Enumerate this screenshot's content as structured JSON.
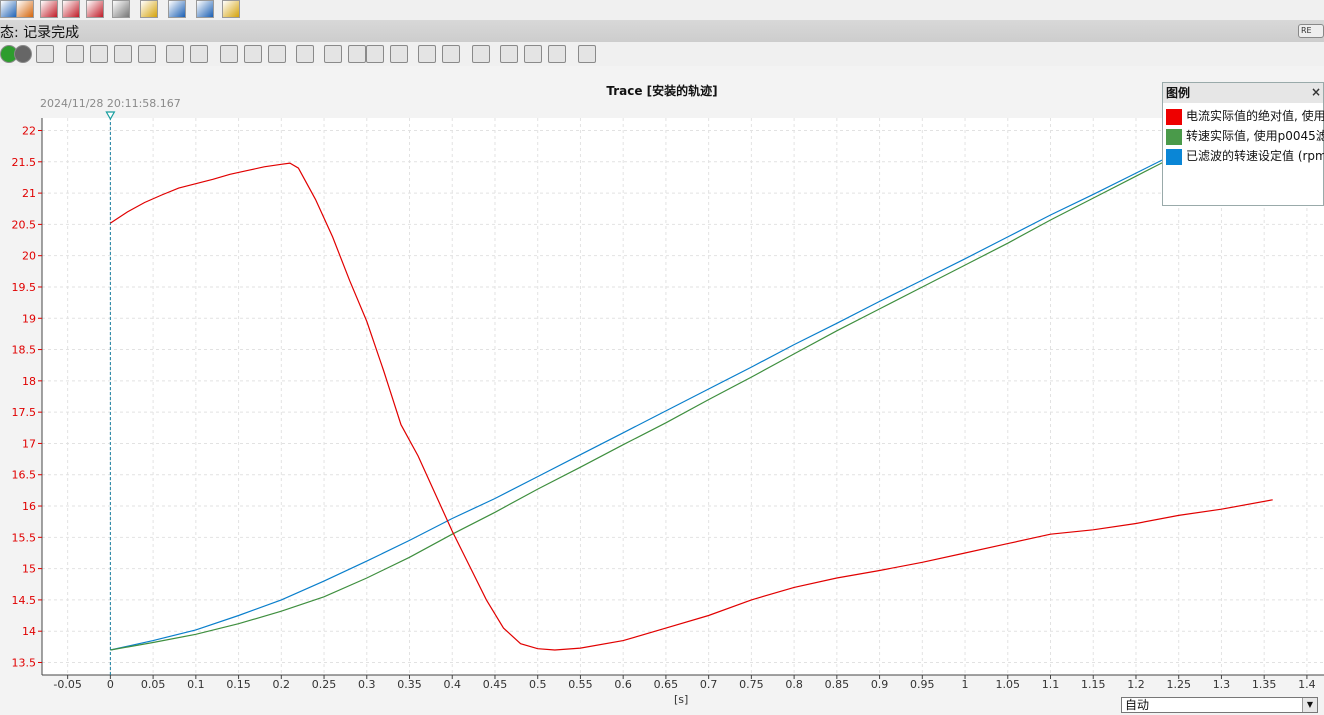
{
  "window": {
    "status_label": "态: 记录完成",
    "rec_badge": "RE"
  },
  "toolbar_icons": [
    "arrow-down-icon",
    "arrow-up-icon",
    "record-icon",
    "record-red-icon",
    "delete-icon",
    "stop-icon",
    "folder-icon",
    "export-icon",
    "import-icon",
    "filter-icon"
  ],
  "toolbar2_icons": [
    "play-green-icon",
    "forward-icon",
    "map-icon",
    "hand-icon",
    "zoom-box-icon",
    "zoom-x-icon",
    "zoom-y-icon",
    "zoom-in-icon",
    "zoom-out-icon",
    "zoom-100-icon",
    "y-100-icon",
    "x-100-icon",
    "chart-icon",
    "time-axis-icon",
    "cursor-icon",
    "line-icon",
    "diagonal-icon",
    "vertical-lines-icon",
    "horizontal-lines-icon",
    "measure-icon",
    "legend-icon",
    "align-left-icon",
    "align-right-icon",
    "download-icon"
  ],
  "chart": {
    "title": "Trace [安装的轨迹]",
    "timestamp": "2024/11/28 20:11:58.167",
    "x_unit": "[s]"
  },
  "legend": {
    "title": "图例",
    "close": "×",
    "items": [
      {
        "label": "电流实际值的绝对值, 使用",
        "color": "#ee0000"
      },
      {
        "label": "转速实际值, 使用p0045滤",
        "color": "#4a9a4a"
      },
      {
        "label": "已滤波的转速设定值 (rpm",
        "color": "#0a86d6"
      }
    ]
  },
  "dropdown": {
    "value": "自动"
  },
  "colors": {
    "current": "#e10000",
    "speed_actual": "#3f8f3f",
    "speed_setpoint": "#0a7fcc",
    "ytick": "#e00000"
  },
  "chart_data": {
    "type": "line",
    "title": "Trace [安装的轨迹]",
    "xlabel": "[s]",
    "xlim": [
      -0.08,
      1.42
    ],
    "ylim": [
      13.3,
      22.2
    ],
    "xticks": [
      -0.05,
      0,
      0.05,
      0.1,
      0.15,
      0.2,
      0.25,
      0.3,
      0.35,
      0.4,
      0.45,
      0.5,
      0.55,
      0.6,
      0.65,
      0.7,
      0.75,
      0.8,
      0.85,
      0.9,
      0.95,
      1,
      1.05,
      1.1,
      1.15,
      1.2,
      1.25,
      1.3,
      1.35,
      1.4
    ],
    "yticks": [
      13.5,
      14,
      14.5,
      15,
      15.5,
      16,
      16.5,
      17,
      17.5,
      18,
      18.5,
      19,
      19.5,
      20,
      20.5,
      21,
      21.5,
      22
    ],
    "grid": true,
    "legend_position": "top-right",
    "series": [
      {
        "name": "电流实际值的绝对值, 使用",
        "x": [
          0,
          0.02,
          0.04,
          0.06,
          0.08,
          0.1,
          0.12,
          0.14,
          0.16,
          0.18,
          0.2,
          0.21,
          0.22,
          0.24,
          0.26,
          0.28,
          0.3,
          0.32,
          0.34,
          0.36,
          0.38,
          0.4,
          0.42,
          0.44,
          0.46,
          0.48,
          0.5,
          0.52,
          0.55,
          0.6,
          0.65,
          0.7,
          0.75,
          0.8,
          0.85,
          0.9,
          0.95,
          1,
          1.05,
          1.1,
          1.15,
          1.2,
          1.25,
          1.3,
          1.36
        ],
        "values": [
          20.52,
          20.7,
          20.85,
          20.97,
          21.08,
          21.15,
          21.22,
          21.3,
          21.36,
          21.42,
          21.46,
          21.48,
          21.4,
          20.9,
          20.3,
          19.6,
          18.95,
          18.15,
          17.3,
          16.8,
          16.2,
          15.6,
          15.05,
          14.5,
          14.05,
          13.8,
          13.72,
          13.7,
          13.73,
          13.85,
          14.05,
          14.25,
          14.5,
          14.7,
          14.85,
          14.97,
          15.1,
          15.25,
          15.4,
          15.55,
          15.62,
          15.72,
          15.85,
          15.95,
          16.1
        ]
      },
      {
        "name": "转速实际值, 使用p0045滤",
        "x": [
          0,
          0.05,
          0.1,
          0.15,
          0.2,
          0.25,
          0.3,
          0.35,
          0.4,
          0.45,
          0.5,
          0.55,
          0.6,
          0.65,
          0.7,
          0.75,
          0.8,
          0.85,
          0.9,
          0.95,
          1,
          1.05,
          1.1,
          1.15,
          1.2,
          1.25
        ],
        "values": [
          13.7,
          13.82,
          13.95,
          14.12,
          14.32,
          14.55,
          14.85,
          15.18,
          15.55,
          15.9,
          16.27,
          16.62,
          16.98,
          17.33,
          17.7,
          18.06,
          18.43,
          18.8,
          19.15,
          19.5,
          19.85,
          20.2,
          20.57,
          20.92,
          21.27,
          21.62
        ]
      },
      {
        "name": "已滤波的转速设定值 (rpm",
        "x": [
          0,
          0.05,
          0.1,
          0.15,
          0.2,
          0.25,
          0.3,
          0.35,
          0.4,
          0.45,
          0.5,
          0.55,
          0.6,
          0.65,
          0.7,
          0.75,
          0.8,
          0.85,
          0.9,
          0.95,
          1,
          1.05,
          1.1,
          1.15,
          1.2,
          1.25
        ],
        "values": [
          13.7,
          13.85,
          14.02,
          14.25,
          14.5,
          14.8,
          15.12,
          15.45,
          15.8,
          16.12,
          16.47,
          16.82,
          17.17,
          17.52,
          17.87,
          18.22,
          18.58,
          18.92,
          19.27,
          19.61,
          19.95,
          20.3,
          20.65,
          20.98,
          21.32,
          21.66
        ]
      }
    ]
  }
}
